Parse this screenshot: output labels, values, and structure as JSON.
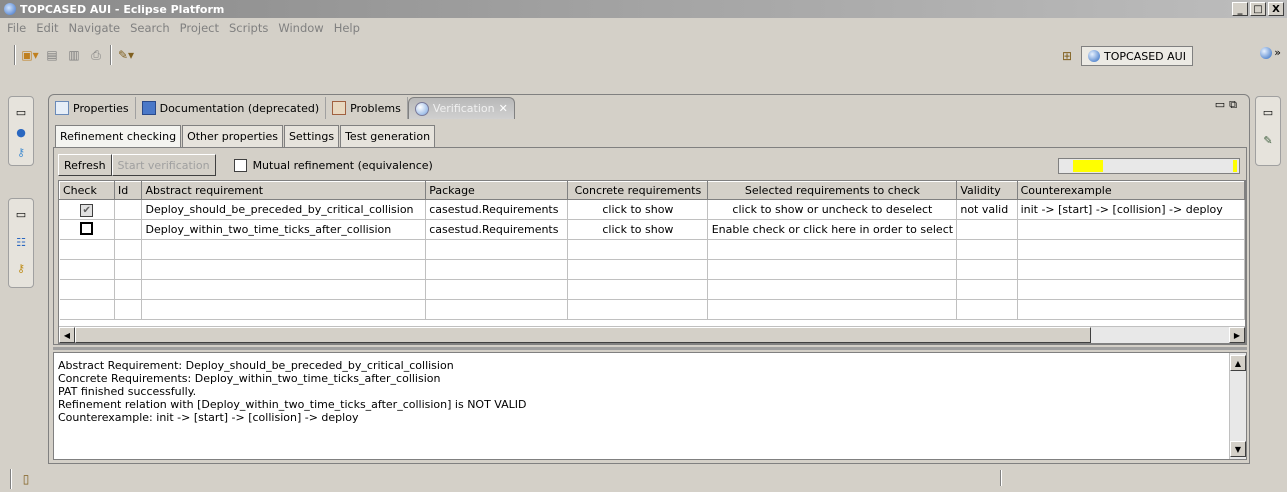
{
  "window": {
    "title": "TOPCASED AUI - Eclipse Platform",
    "controls": [
      "_",
      "□",
      "X"
    ]
  },
  "menu": [
    "File",
    "Edit",
    "Navigate",
    "Search",
    "Project",
    "Scripts",
    "Window",
    "Help"
  ],
  "toolbar": {
    "icons": [
      "new-wizard-icon",
      "save-icon",
      "save-all-icon",
      "print-icon",
      "run-tool-icon"
    ]
  },
  "perspective": {
    "label": "TOPCASED AUI",
    "overflow": "»"
  },
  "view_tabs": [
    {
      "label": "Properties",
      "icon": "properties-icon"
    },
    {
      "label": "Documentation (deprecated)",
      "icon": "documentation-icon"
    },
    {
      "label": "Problems",
      "icon": "problems-icon"
    },
    {
      "label": "Verification",
      "icon": "verification-icon",
      "active": true
    }
  ],
  "inner_tabs": [
    "Refinement checking",
    "Other properties",
    "Settings",
    "Test generation"
  ],
  "controls": {
    "refresh": "Refresh",
    "start_verification": "Start verification",
    "mutual_refinement": "Mutual refinement (equivalence)",
    "mutual_refinement_checked": false
  },
  "progress": {
    "colors": {
      "fill": "#ffff00"
    }
  },
  "table": {
    "columns": [
      "Check",
      "Id",
      "Abstract requirement",
      "Package",
      "Concrete requirements",
      "Selected requirements to check",
      "Validity",
      "Counterexample"
    ],
    "rows": [
      {
        "check": true,
        "id": "",
        "abstract": "Deploy_should_be_preceded_by_critical_collision",
        "package": "casestud.Requirements",
        "concrete": "click to show",
        "selected": "click to show or uncheck to deselect",
        "validity": "not valid",
        "counterexample": "init -> [start] -> [collision] -> deploy"
      },
      {
        "check": false,
        "id": "",
        "abstract": "Deploy_within_two_time_ticks_after_collision",
        "package": "casestud.Requirements",
        "concrete": "click to show",
        "selected": "Enable check or click here in order to select",
        "validity": "",
        "counterexample": ""
      }
    ]
  },
  "console": {
    "lines": [
      "Abstract Requirement: Deploy_should_be_preceded_by_critical_collision",
      "Concrete Requirements: Deploy_within_two_time_ticks_after_collision",
      "PAT finished successfully.",
      "Refinement relation with [Deploy_within_two_time_ticks_after_collision] is NOT VALID",
      "Counterexample: init -> [start] -> [collision] -> deploy"
    ]
  }
}
